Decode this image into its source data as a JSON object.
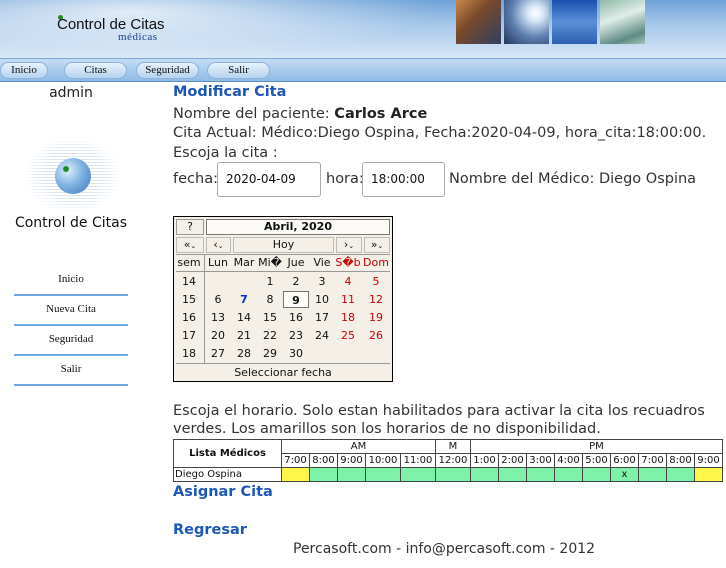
{
  "header": {
    "brand_title": "Control de Citas",
    "brand_subtitle": "médicas"
  },
  "nav": {
    "items": [
      "Inicio",
      "Citas",
      "Seguridad",
      "Salir"
    ]
  },
  "sidebar": {
    "user": "admin",
    "app_title": "Control de Citas",
    "items": [
      "Inicio",
      "Nueva Cita",
      "Seguridad",
      "Salir"
    ]
  },
  "main": {
    "title": "Modificar Cita",
    "patient_prefix": "Nombre del paciente: ",
    "patient_name": "Carlos Arce",
    "current_appt": "Cita Actual: Médico:Diego Ospina, Fecha:2020-04-09, hora_cita:18:00:00.",
    "choose_appt": "Escoja la cita :",
    "fecha_label": "fecha:",
    "fecha_value": "2020-04-09",
    "hora_label": "hora:",
    "hora_value": "18:00:00",
    "doctor_text": "Nombre del Médico: Diego Ospina"
  },
  "calendar": {
    "help_button": "?",
    "month_title": "Abril, 2020",
    "nav_prev_year": "«",
    "nav_prev_month": "‹",
    "today_label": "Hoy",
    "nav_next_month": "›",
    "nav_next_year": "»",
    "week_header": "sem",
    "day_headers": [
      "Lun",
      "Mar",
      "Mi�",
      "Jue",
      "Vie",
      "S�b",
      "Dom"
    ],
    "weeks": [
      {
        "week": "14",
        "days": [
          "",
          "",
          "1",
          "2",
          "3",
          "4",
          "5"
        ]
      },
      {
        "week": "15",
        "days": [
          "6",
          "7",
          "8",
          "9",
          "10",
          "11",
          "12"
        ]
      },
      {
        "week": "16",
        "days": [
          "13",
          "14",
          "15",
          "16",
          "17",
          "18",
          "19"
        ]
      },
      {
        "week": "17",
        "days": [
          "20",
          "21",
          "22",
          "23",
          "24",
          "25",
          "26"
        ]
      },
      {
        "week": "18",
        "days": [
          "27",
          "28",
          "29",
          "30",
          "",
          "",
          ""
        ]
      }
    ],
    "selected_day": "9",
    "highlight_day": "7",
    "footer": "Seleccionar fecha",
    "colors": {
      "weekend": "#cc0000",
      "highlight": "#0033cc"
    }
  },
  "schedule": {
    "intro": "Escoja el horario. Solo estan habilitados para activar la cita los recuadros verdes. Los amarillos son los horarios de no disponibilidad.",
    "list_header": "Lista Médicos",
    "groups": [
      {
        "label": "AM"
      },
      {
        "label": "M"
      },
      {
        "label": "PM"
      }
    ],
    "hours": [
      "7:00",
      "8:00",
      "9:00",
      "10:00",
      "11:00",
      "12:00",
      "1:00",
      "2:00",
      "3:00",
      "4:00",
      "5:00",
      "6:00",
      "7:00",
      "8:00",
      "9:00"
    ],
    "doctors": [
      {
        "name": "Diego Ospina",
        "slots": [
          "yellow",
          "green",
          "green",
          "green",
          "green",
          "green",
          "green",
          "green",
          "green",
          "green",
          "green",
          "green",
          "green",
          "green",
          "yellow"
        ],
        "marks": [
          "",
          "",
          "",
          "",
          "",
          "",
          "",
          "",
          "",
          "",
          "",
          "x",
          "",
          "",
          ""
        ]
      }
    ],
    "colors": {
      "available": "#7ef2a8",
      "unavailable": "#fff64a"
    }
  },
  "actions": {
    "assign": "Asignar Cita",
    "back": "Regresar"
  },
  "footer": {
    "text": "Percasoft.com - info@percasoft.com - 2012"
  }
}
